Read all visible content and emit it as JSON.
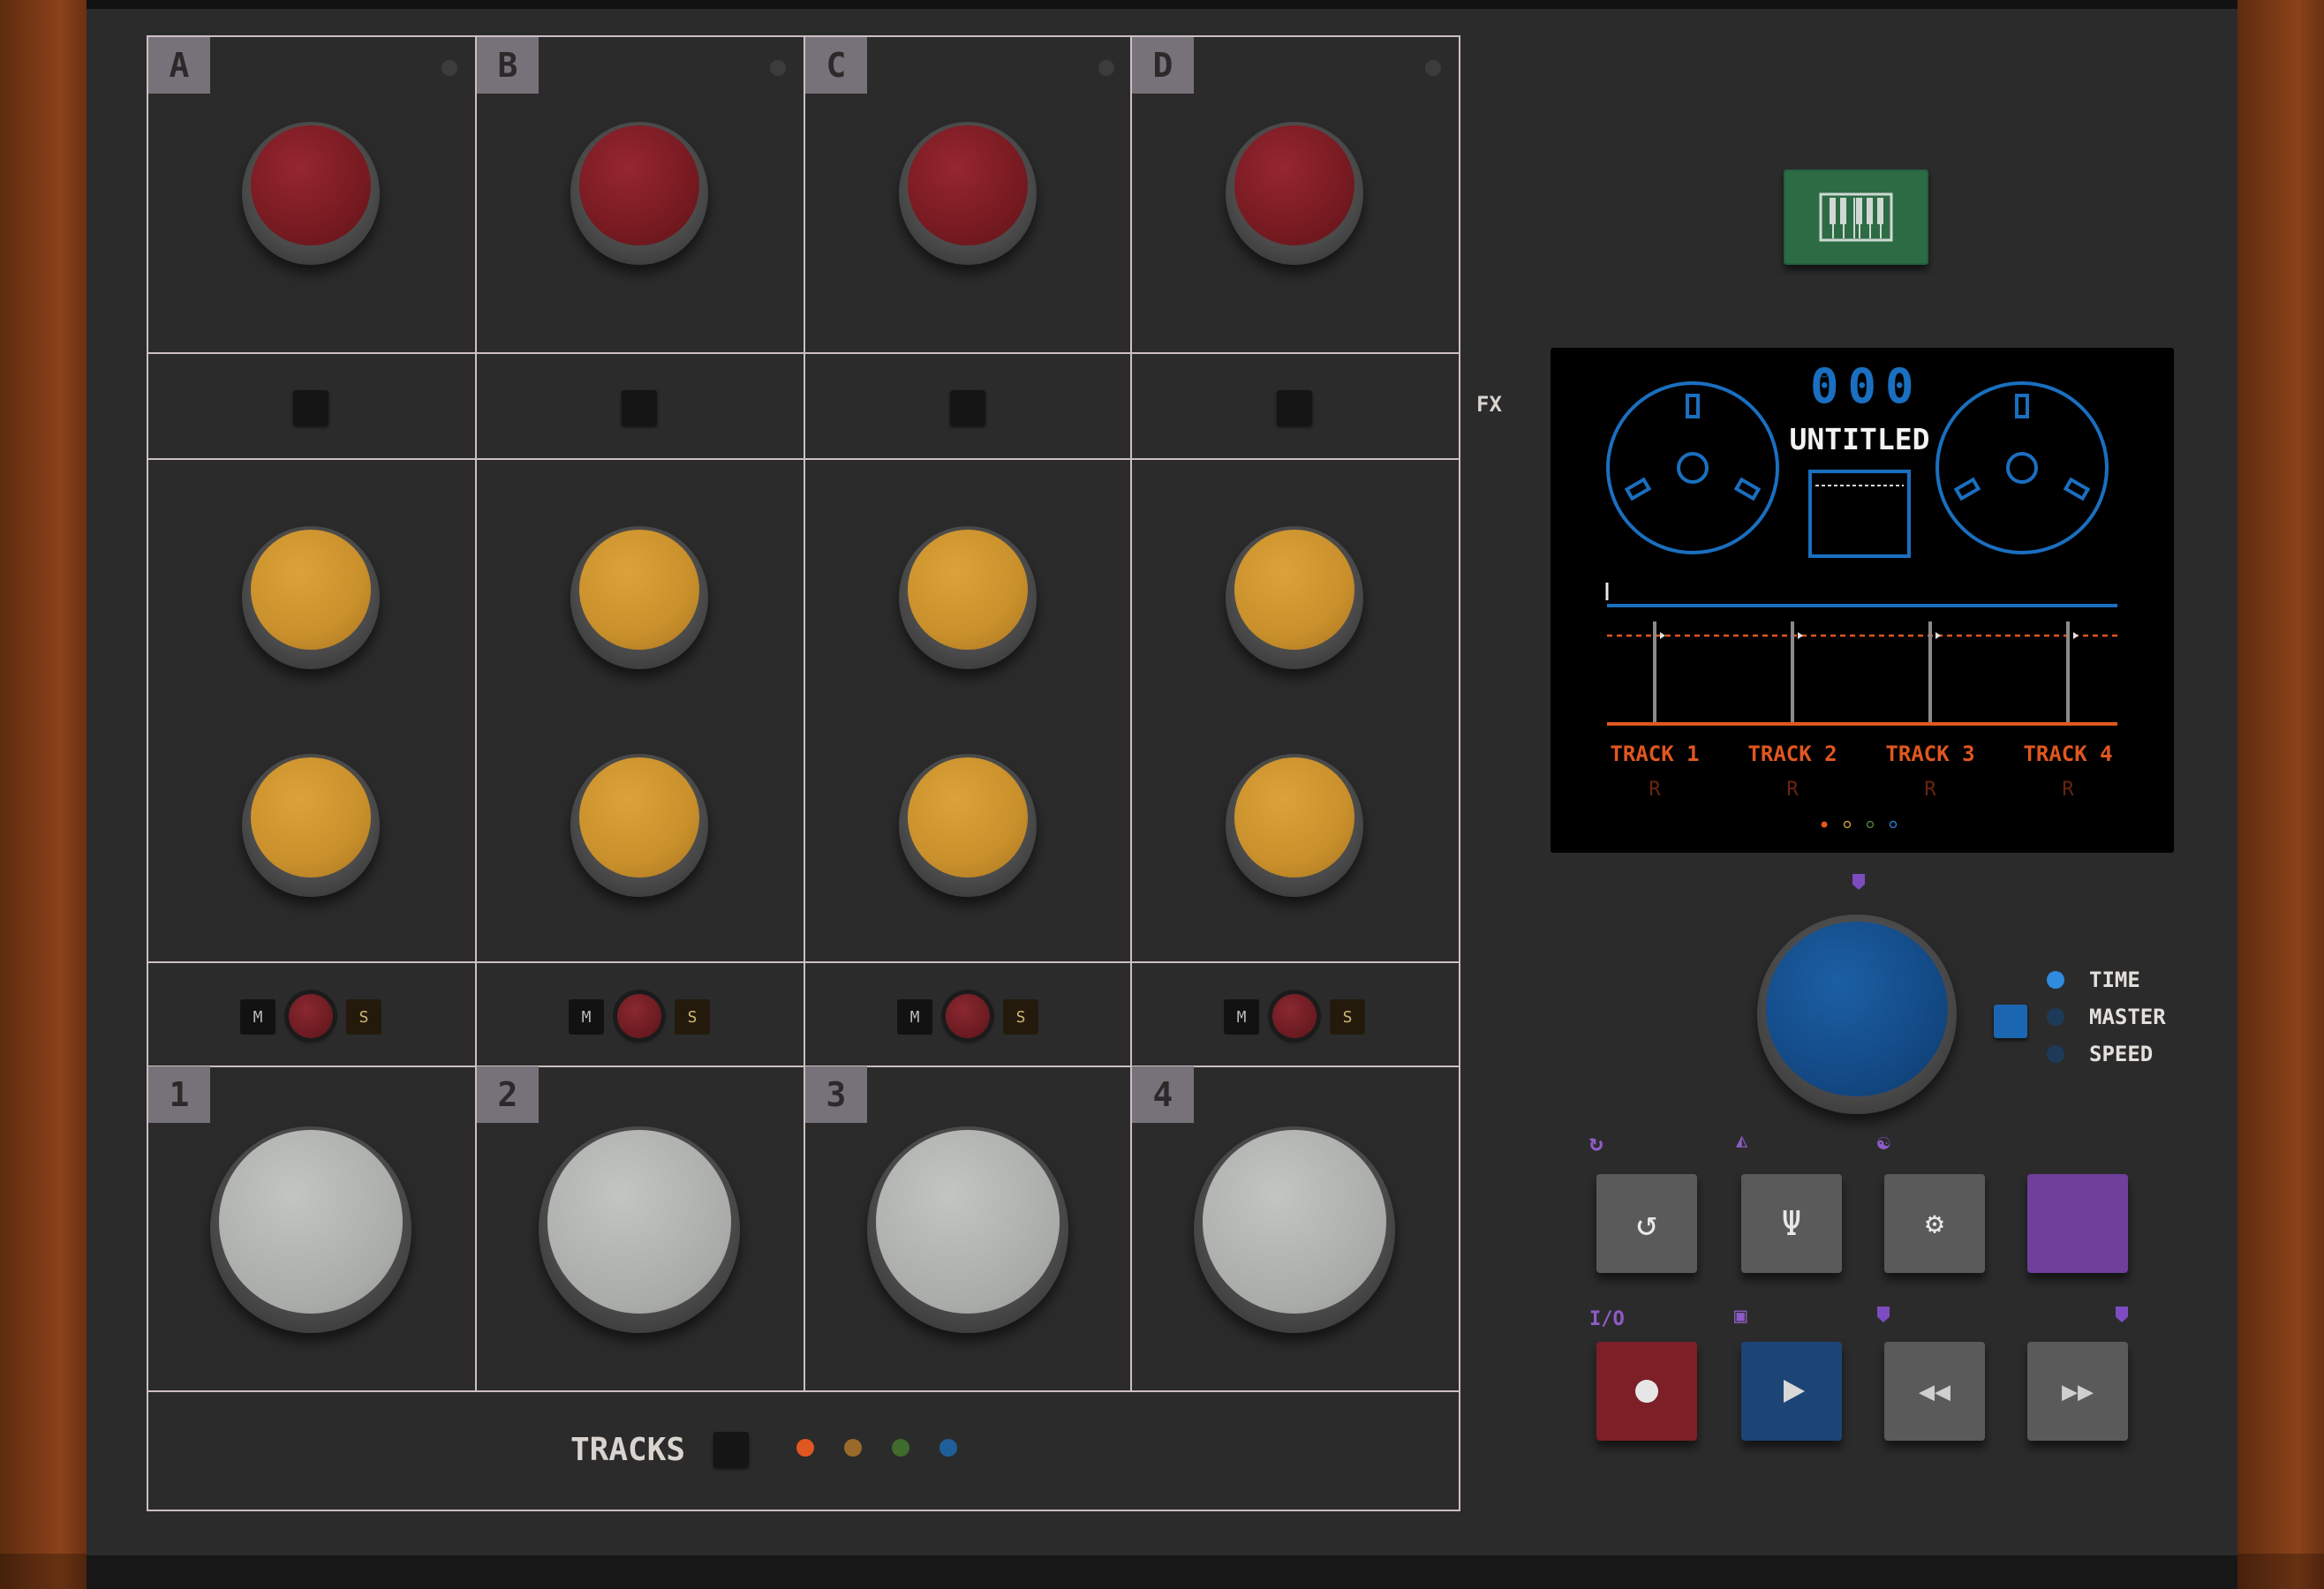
{
  "channels": [
    {
      "letter": "A",
      "number": "1"
    },
    {
      "letter": "B",
      "number": "2"
    },
    {
      "letter": "C",
      "number": "3"
    },
    {
      "letter": "D",
      "number": "4"
    }
  ],
  "mute_label": "M",
  "solo_label": "S",
  "fx_label": "FX",
  "tracks_label": "TRACKS",
  "track_colors": [
    "#e0571f",
    "#9a6a2a",
    "#3f6b2d",
    "#1e5f9a"
  ],
  "screen": {
    "counter": "000",
    "title": "UNTITLED",
    "tracks": [
      {
        "label": "TRACK 1",
        "mode": "R"
      },
      {
        "label": "TRACK 2",
        "mode": "R"
      },
      {
        "label": "TRACK 3",
        "mode": "R"
      },
      {
        "label": "TRACK 4",
        "mode": "R"
      }
    ],
    "reel_color": "#1a6fc0",
    "track_color": "#e0571f"
  },
  "encoder_modes": [
    {
      "label": "TIME",
      "active": true
    },
    {
      "label": "MASTER",
      "active": false
    },
    {
      "label": "SPEED",
      "active": false
    }
  ],
  "io_label": "I/O",
  "icons": {
    "loop": "loop-icon",
    "tuner": "tuning-fork-icon",
    "settings": "gear-icon",
    "record": "record-icon",
    "play": "play-icon",
    "rewind": "rewind-icon",
    "fast_forward": "fast-forward-icon",
    "piano": "piano-keys-icon",
    "metronome": "metronome-icon",
    "yin_yang": "yin-yang-icon",
    "save": "save-icon"
  }
}
